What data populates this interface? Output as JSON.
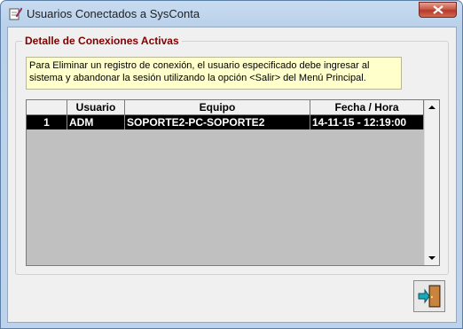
{
  "window": {
    "title": "Usuarios Conectados a SysConta",
    "app_icon": "report-edit-icon",
    "close_icon": "close-x-icon"
  },
  "group": {
    "title": "Detalle de Conexiones Activas",
    "info_text": "Para Eliminar un registro de conexión, el usuario especificado debe ingresar al sistema y abandonar la sesión utilizando la opción <Salir> del Menú Principal."
  },
  "grid": {
    "columns": [
      "",
      "Usuario",
      "Equipo",
      "Fecha / Hora"
    ],
    "rows": [
      {
        "index": "1",
        "usuario": "ADM",
        "equipo": "SOPORTE2-PC-SOPORTE2",
        "fecha_hora": "14-11-15 - 12:19:00"
      }
    ]
  },
  "buttons": {
    "exit_icon": "exit-door-icon"
  },
  "colors": {
    "group_title": "#800000",
    "info_background": "#ffffcc",
    "selected_row": "#000000",
    "grid_empty": "#c0c0c0"
  }
}
